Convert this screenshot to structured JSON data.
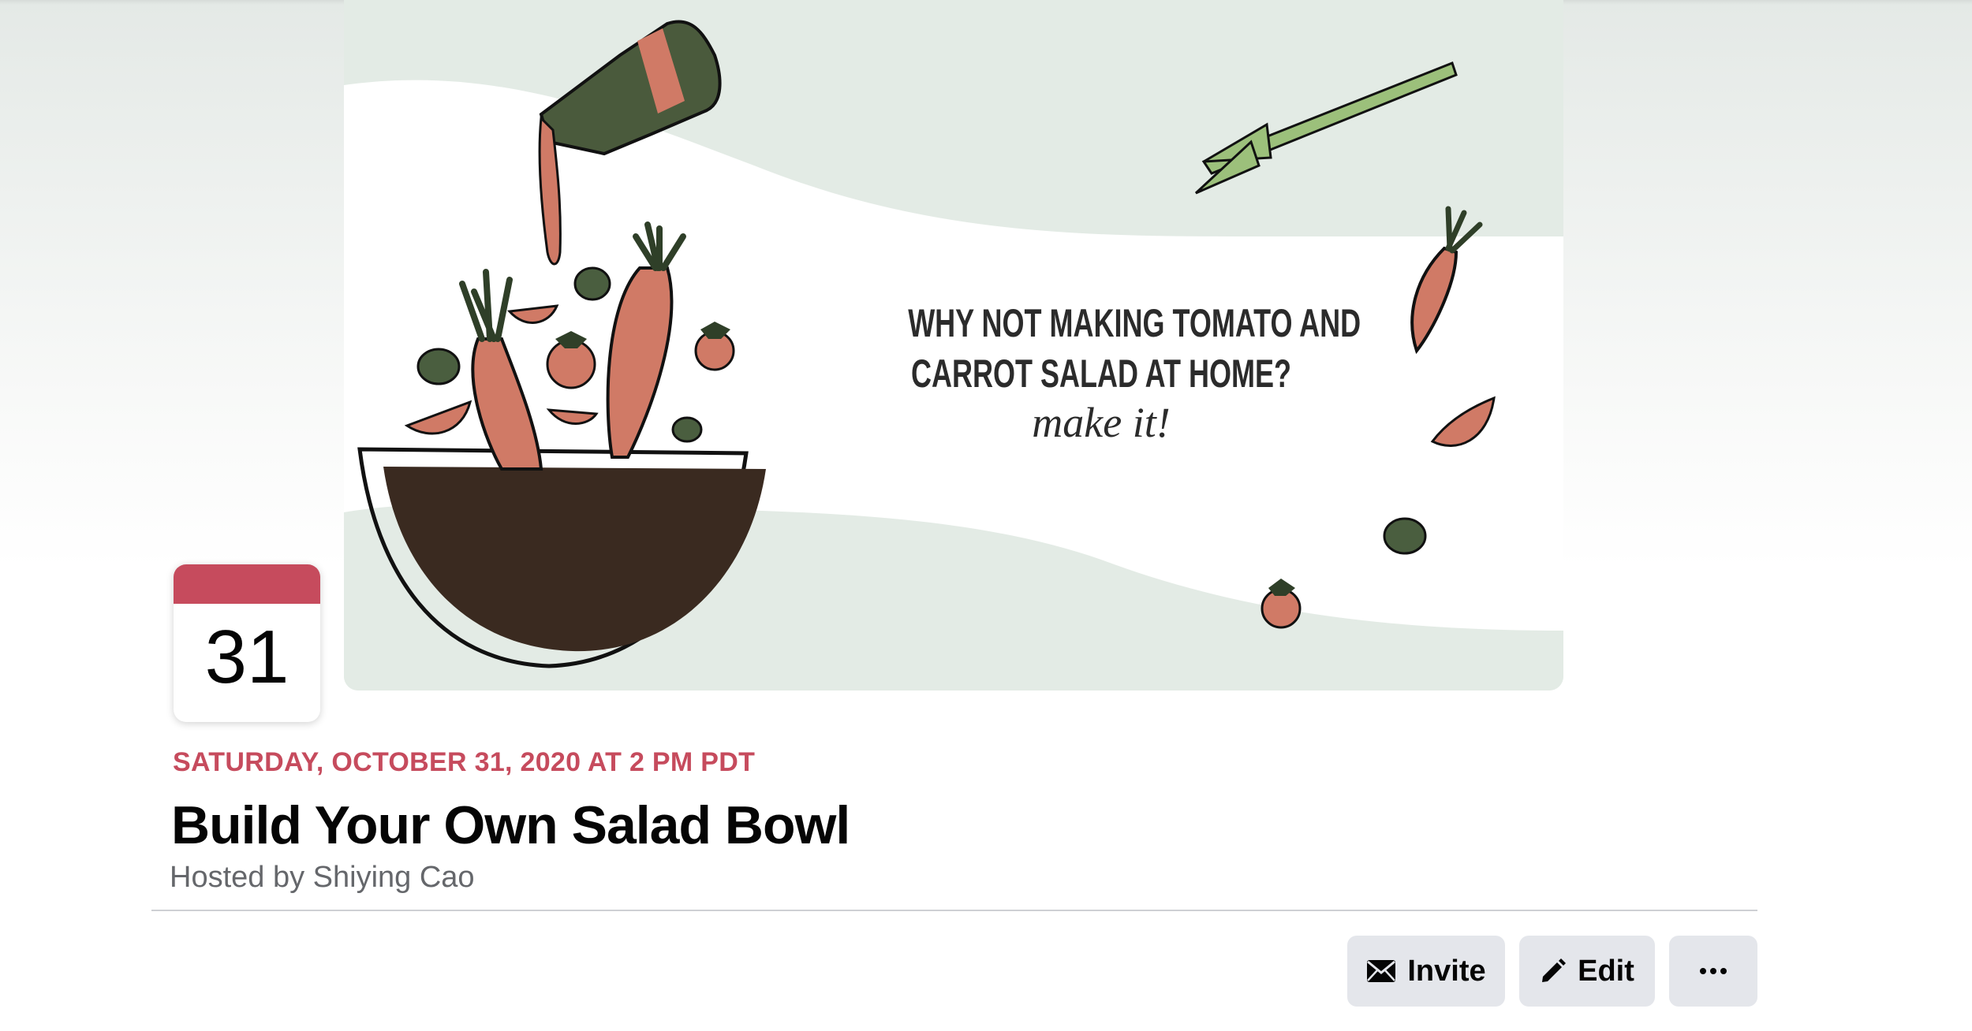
{
  "cover": {
    "line1": "WHY NOT MAKING TOMATO AND",
    "line2": "CARROT SALAD AT HOME?",
    "line3": "make it!",
    "colors": {
      "background": "#e3ebe5",
      "wave": "#ffffff",
      "bowl": "#3a2a20",
      "carrot": "#d07a66",
      "leaf": "#4a5e3f",
      "bottle": "#4a5a3c"
    }
  },
  "calendar": {
    "day": "31",
    "accent": "#c64b5d"
  },
  "event": {
    "date": "SATURDAY, OCTOBER 31, 2020 AT 2 PM PDT",
    "title": "Build Your Own Salad Bowl",
    "host": "Hosted by Shiying Cao"
  },
  "actions": {
    "invite_label": "Invite",
    "invite_icon": "envelope-icon",
    "edit_label": "Edit",
    "edit_icon": "pencil-icon",
    "more_icon": "ellipsis-icon"
  }
}
